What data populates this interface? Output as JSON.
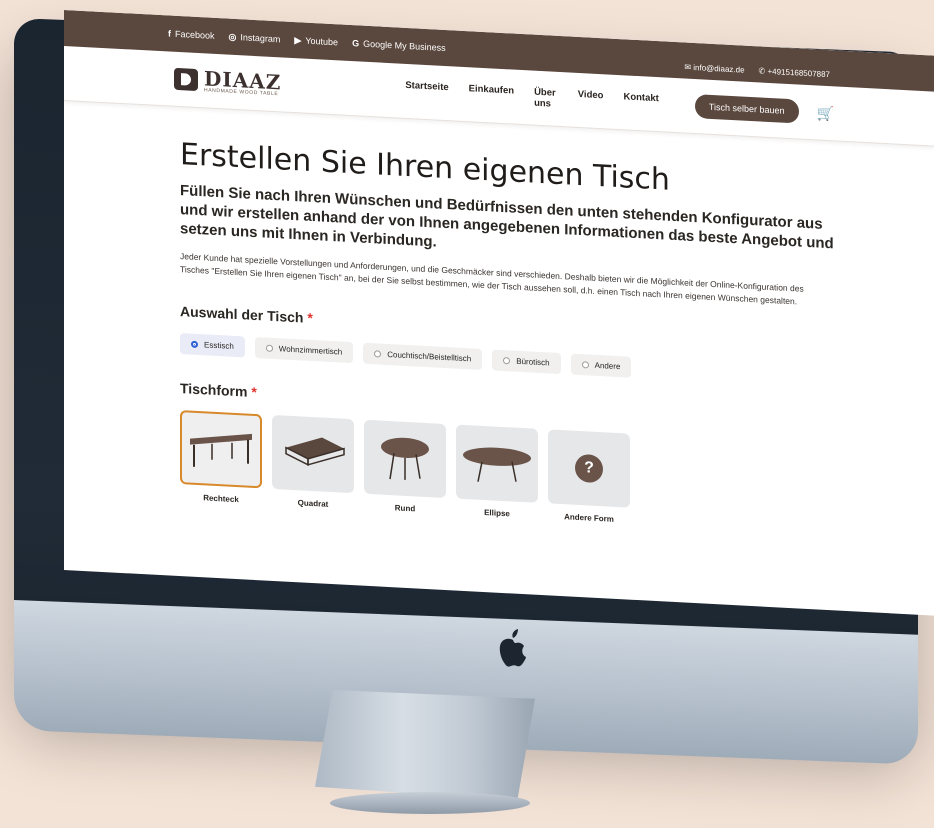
{
  "topbar": {
    "social": [
      {
        "icon": "facebook-icon",
        "glyph": "f",
        "label": "Facebook"
      },
      {
        "icon": "instagram-icon",
        "glyph": "◎",
        "label": "Instagram"
      },
      {
        "icon": "youtube-icon",
        "glyph": "▶",
        "label": "Youtube"
      },
      {
        "icon": "google-icon",
        "glyph": "G",
        "label": "Google My Business"
      }
    ],
    "email": "info@diaaz.de",
    "phone": "+4915168507887"
  },
  "header": {
    "logo_name": "DIAAZ",
    "logo_tagline": "HANDMADE WOOD TABLE",
    "menu": [
      "Startseite",
      "Einkaufen",
      "Über uns",
      "Video",
      "Kontakt"
    ],
    "cta_label": "Tisch selber bauen"
  },
  "main": {
    "title": "Erstellen Sie Ihren eigenen Tisch",
    "lead": "Füllen Sie nach Ihren Wünschen und Bedürfnissen den unten stehenden Konfigurator aus und wir erstellen anhand der von Ihnen angegebenen Informationen das beste Angebot und setzen uns mit Ihnen in Verbindung.",
    "description": "Jeder Kunde hat spezielle Vorstellungen und Anforderungen, und die Geschmäcker sind verschieden. Deshalb bieten wir die Möglichkeit der Online-Konfiguration des Tisches \"Erstellen Sie Ihren eigenen Tisch\" an, bei der Sie selbst bestimmen, wie der Tisch aussehen soll, d.h. einen Tisch nach Ihren eigenen Wünschen gestalten.",
    "table_choice": {
      "title": "Auswahl der Tisch",
      "required_mark": "*",
      "options": [
        "Esstisch",
        "Wohnzimmertisch",
        "Couchtisch/Beistelltisch",
        "Bürotisch",
        "Andere"
      ],
      "selected": "Esstisch"
    },
    "shape": {
      "title": "Tischform",
      "required_mark": "*",
      "options": [
        "Rechteck",
        "Quadrat",
        "Rund",
        "Ellipse",
        "Andere Form"
      ],
      "selected": "Rechteck",
      "other_glyph": "?"
    }
  },
  "colors": {
    "brand_brown": "#5a473d",
    "selected_border": "#d8892b",
    "radio_selected": "#2d5fd6",
    "required": "#e0332f"
  }
}
